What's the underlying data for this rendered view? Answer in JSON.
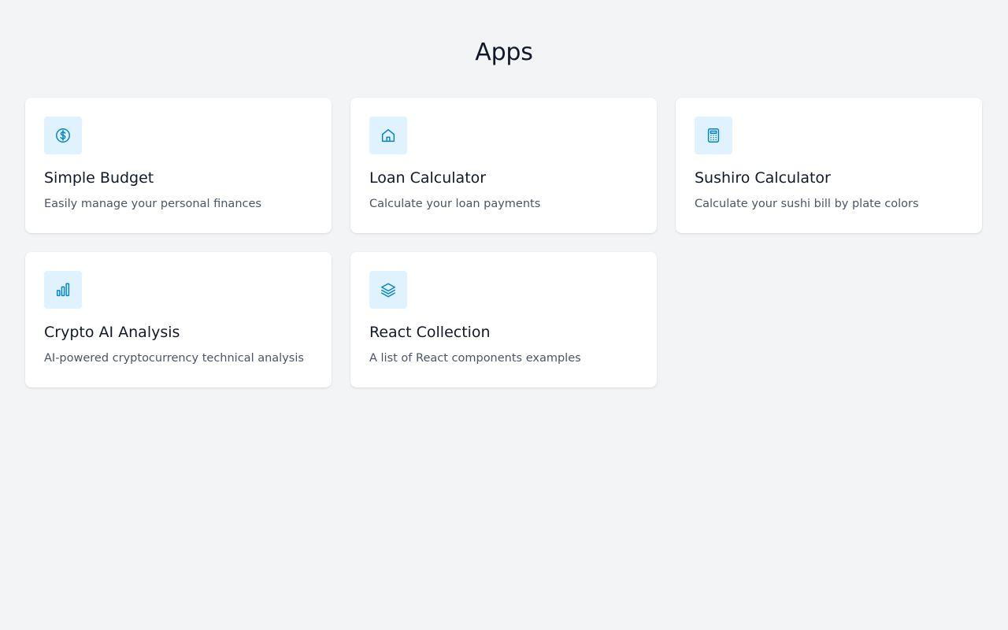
{
  "header": {
    "title": "Apps"
  },
  "apps": [
    {
      "title": "Simple Budget",
      "description": "Easily manage your personal finances",
      "icon": "dollar-circle-icon"
    },
    {
      "title": "Loan Calculator",
      "description": "Calculate your loan payments",
      "icon": "home-icon"
    },
    {
      "title": "Sushiro Calculator",
      "description": "Calculate your sushi bill by plate colors",
      "icon": "calculator-icon"
    },
    {
      "title": "Crypto AI Analysis",
      "description": "AI-powered cryptocurrency technical analysis",
      "icon": "bar-chart-icon"
    },
    {
      "title": "React Collection",
      "description": "A list of React components examples",
      "icon": "layers-icon"
    }
  ],
  "colors": {
    "background": "#f3f4f6",
    "card": "#ffffff",
    "icon_bg": "#e0f2fe",
    "icon_stroke": "#0284c7",
    "title": "#111827",
    "description": "#4b5563"
  }
}
